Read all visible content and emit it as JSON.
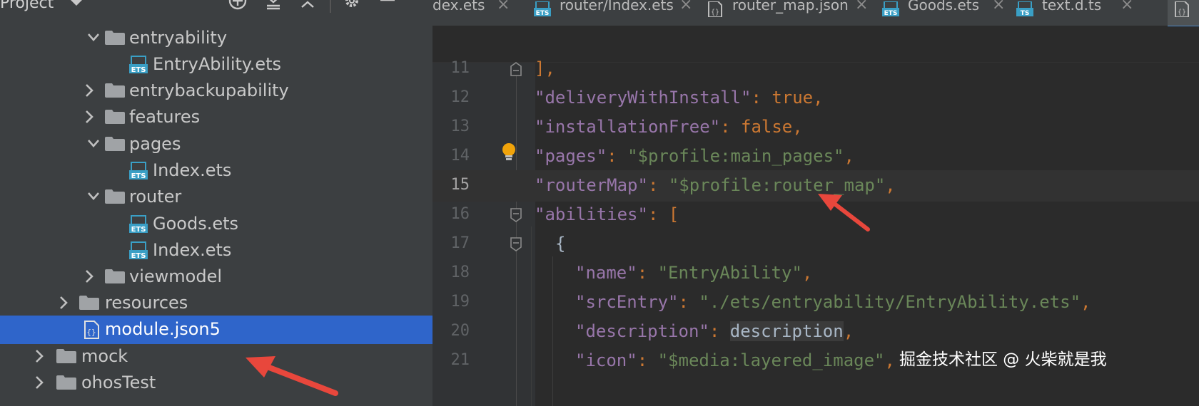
{
  "sidebar": {
    "title": "Project",
    "header_icons": [
      "add-target-icon",
      "expand-all-icon",
      "collapse-all-icon",
      "gear-icon",
      "hide-icon"
    ],
    "tree": [
      {
        "label": "entryability",
        "type": "folder",
        "expanded": true
      },
      {
        "label": "EntryAbility.ets",
        "type": "ets-file"
      },
      {
        "label": "entrybackupability",
        "type": "folder",
        "expanded": false
      },
      {
        "label": "features",
        "type": "folder",
        "expanded": false
      },
      {
        "label": "pages",
        "type": "folder",
        "expanded": true
      },
      {
        "label": "Index.ets",
        "type": "ets-file"
      },
      {
        "label": "router",
        "type": "folder",
        "expanded": true
      },
      {
        "label": "Goods.ets",
        "type": "ets-file"
      },
      {
        "label": "Index.ets",
        "type": "ets-file"
      },
      {
        "label": "viewmodel",
        "type": "folder",
        "expanded": false
      },
      {
        "label": "resources",
        "type": "folder",
        "expanded": false
      },
      {
        "label": "module.json5",
        "type": "json-file",
        "selected": true
      },
      {
        "label": "mock",
        "type": "folder",
        "expanded": false
      },
      {
        "label": "ohosTest",
        "type": "folder",
        "expanded": false
      }
    ]
  },
  "tabs": [
    {
      "label": "dex.ets",
      "icon": "none"
    },
    {
      "label": "router/Index.ets",
      "icon": "ets-file-icon"
    },
    {
      "label": "router_map.json",
      "icon": "json-file-icon"
    },
    {
      "label": "Goods.ets",
      "icon": "ets-file-icon"
    },
    {
      "label": "text.d.ts",
      "icon": "ts-file-icon"
    }
  ],
  "editor": {
    "current_line": "15",
    "lines": [
      {
        "n": "11",
        "code": "],"
      },
      {
        "n": "12",
        "code": "\"deliveryWithInstall\": true,"
      },
      {
        "n": "13",
        "code": "\"installationFree\": false,"
      },
      {
        "n": "14",
        "code": "\"pages\": \"$profile:main_pages\","
      },
      {
        "n": "15",
        "code": "\"routerMap\": \"$profile:router_map\","
      },
      {
        "n": "16",
        "code": "\"abilities\": ["
      },
      {
        "n": "17",
        "code": "{"
      },
      {
        "n": "18",
        "code": "\"name\": \"EntryAbility\","
      },
      {
        "n": "19",
        "code": "\"srcEntry\": \"./ets/entryability/EntryAbility.ets\","
      },
      {
        "n": "20",
        "code": "\"description\": description,"
      },
      {
        "n": "21",
        "code": "\"icon\": \"$media:layered_image\","
      }
    ]
  },
  "watermark": "掘金技术社区 @ 火柴就是我",
  "colors": {
    "sidebar_bg": "#3c3f41",
    "editor_bg": "#2b2b2b",
    "selection": "#2f65ca",
    "key": "#9876aa",
    "string": "#6a8759",
    "keyword": "#cc7832",
    "annotation_arrow": "#e8473c"
  }
}
